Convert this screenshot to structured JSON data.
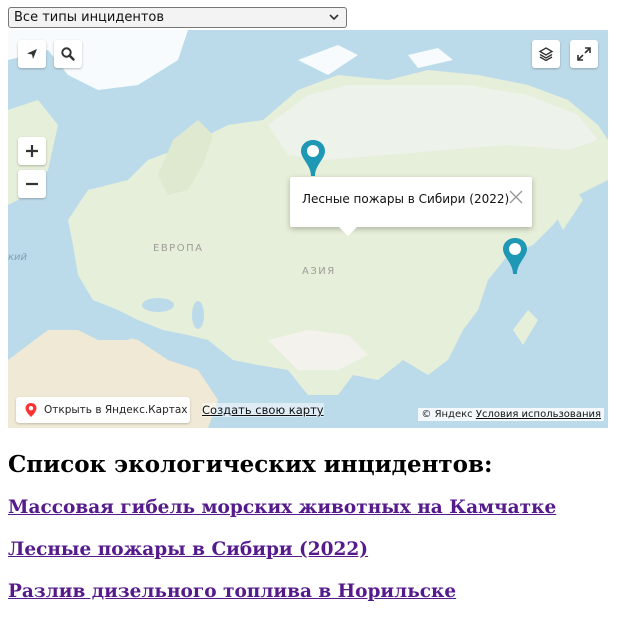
{
  "filter": {
    "selected": "Все типы инцидентов"
  },
  "map": {
    "controls": [
      "geolocation-icon",
      "search-icon",
      "layers-icon",
      "fullscreen-icon",
      "zoom-in-icon",
      "zoom-out-icon"
    ],
    "regions": {
      "europe": "ЕВРОПА",
      "asia": "АЗИЯ",
      "edge_fragment": "кий"
    },
    "balloon": {
      "text": "Лесные пожары в Сибири (2022)"
    },
    "open_in_yandex": "Открыть в Яндекс.Картах",
    "create_map": "Создать свою карту",
    "copyright": "© Яндекс",
    "terms": "Условия использования",
    "colors": {
      "pin": "#1e98b5",
      "water": "#bcdbea",
      "land": "#e6efd9",
      "ice": "#ffffff"
    }
  },
  "list": {
    "heading": "Список экологических инцидентов:",
    "items": [
      "Массовая гибель морских животных на Камчатке",
      "Лесные пожары в Сибири (2022)",
      "Разлив дизельного топлива в Норильске"
    ]
  }
}
